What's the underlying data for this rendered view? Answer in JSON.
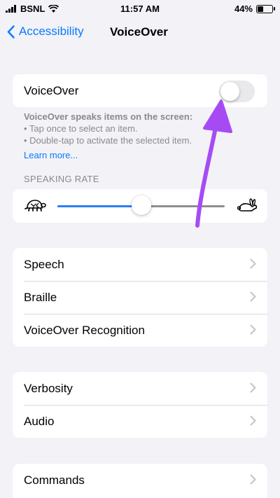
{
  "status": {
    "carrier": "BSNL",
    "time": "11:57 AM",
    "battery": "44%",
    "battery_level": 0.44
  },
  "nav": {
    "back_label": "Accessibility",
    "title": "VoiceOver"
  },
  "voiceover": {
    "label": "VoiceOver",
    "enabled": false,
    "desc_line1": "VoiceOver speaks items on the screen:",
    "desc_line2": "• Tap once to select an item.",
    "desc_line3": "• Double-tap to activate the selected item.",
    "learn_more": "Learn more..."
  },
  "speaking_rate": {
    "header": "SPEAKING RATE",
    "value": 0.5
  },
  "group1": [
    "Speech",
    "Braille",
    "VoiceOver Recognition"
  ],
  "group2": [
    "Verbosity",
    "Audio"
  ],
  "group3": [
    "Commands"
  ],
  "colors": {
    "accent": "#0a7aff",
    "annotation_arrow": "#a64bf4"
  }
}
